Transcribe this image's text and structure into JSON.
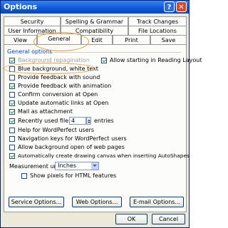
{
  "window": {
    "title": "Options"
  },
  "tabs": {
    "row1": [
      "Security",
      "Spelling & Grammar",
      "Track Changes"
    ],
    "row2": [
      "User Information",
      "Compatibility",
      "File Locations"
    ],
    "row3": [
      "View",
      "General",
      "Edit",
      "Print",
      "Save"
    ],
    "active": "General"
  },
  "general": {
    "section_title": "General options",
    "options": [
      {
        "label": "Background repagination",
        "checked": true,
        "disabled": true
      },
      {
        "label": "Blue background, white text",
        "checked": false
      },
      {
        "label": "Provide feedback with sound",
        "checked": false
      },
      {
        "label": "Provide feedback with animation",
        "checked": true
      },
      {
        "label": "Confirm conversion at Open",
        "checked": false
      },
      {
        "label": "Update automatic links at Open",
        "checked": true
      },
      {
        "label": "Mail as attachment",
        "checked": true
      },
      {
        "label": "Recently used file list:",
        "checked": true,
        "value": "4",
        "suffix": "entries"
      },
      {
        "label": "Help for WordPerfect users",
        "checked": false
      },
      {
        "label": "Navigation keys for WordPerfect users",
        "checked": false
      },
      {
        "label": "Allow background open of web pages",
        "checked": false
      },
      {
        "label": "Automatically create drawing canvas when inserting AutoShapes",
        "checked": true
      }
    ],
    "reading_layout": {
      "label": "Allow starting in Reading Layout",
      "checked": true
    },
    "measurement": {
      "label": "Measurement units:",
      "value": "Inches"
    },
    "pixels": {
      "label": "Show pixels for HTML features",
      "checked": false
    }
  },
  "buttons": {
    "service": "Service Options...",
    "web": "Web Options...",
    "email": "E-mail Options...",
    "ok": "OK",
    "cancel": "Cancel"
  },
  "annotation_color": "#e8982a"
}
